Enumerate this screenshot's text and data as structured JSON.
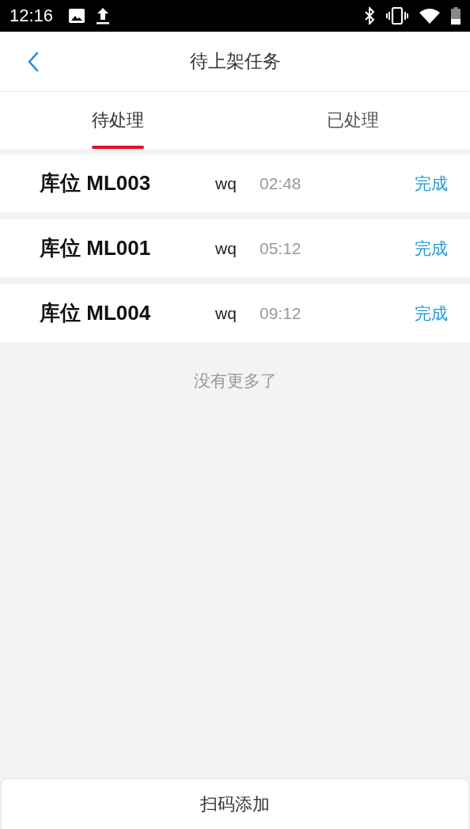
{
  "status_bar": {
    "time": "12:16"
  },
  "header": {
    "title": "待上架任务"
  },
  "tabs": [
    {
      "label": "待处理",
      "selected": true
    },
    {
      "label": "已处理",
      "selected": false
    }
  ],
  "tasks": [
    {
      "location": "库位 ML003",
      "user": "wq",
      "time": "02:48",
      "action": "完成"
    },
    {
      "location": "库位 ML001",
      "user": "wq",
      "time": "05:12",
      "action": "完成"
    },
    {
      "location": "库位 ML004",
      "user": "wq",
      "time": "09:12",
      "action": "完成"
    }
  ],
  "end_message": "没有更多了",
  "bottom_button": "扫码添加"
}
